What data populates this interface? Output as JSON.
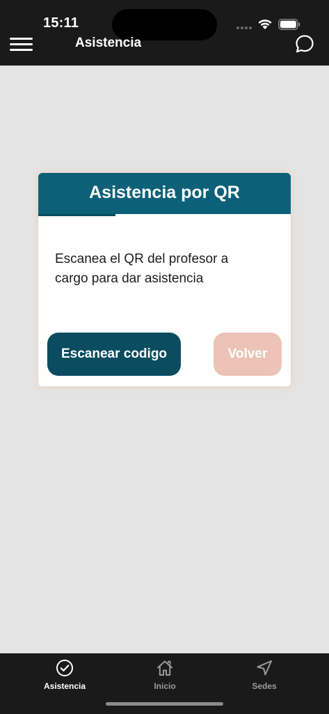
{
  "status_bar": {
    "time": "15:11",
    "icons": [
      "cellular-signal-icon",
      "wifi-icon",
      "battery-icon"
    ]
  },
  "header": {
    "title": "Asistencia",
    "menu_icon": "hamburger-menu-icon",
    "chat_icon": "chat-bubble-icon"
  },
  "card": {
    "title": "Asistencia por QR",
    "message": "Escanea el QR del profesor a cargo para dar asistencia",
    "scan_button_label": "Escanear codigo",
    "back_button_label": "Volver"
  },
  "tab_bar": {
    "tabs": [
      {
        "label": "Asistencia",
        "icon": "check-circle-icon",
        "active": true
      },
      {
        "label": "Inicio",
        "icon": "home-icon",
        "active": false
      },
      {
        "label": "Sedes",
        "icon": "navigation-arrow-icon",
        "active": false
      }
    ]
  },
  "colors": {
    "top_bar": "#1a1a1a",
    "background": "#e4e4e4",
    "card_header": "#0c6179",
    "primary_button": "#0b4c61",
    "secondary_button": "#ecc3b6"
  }
}
